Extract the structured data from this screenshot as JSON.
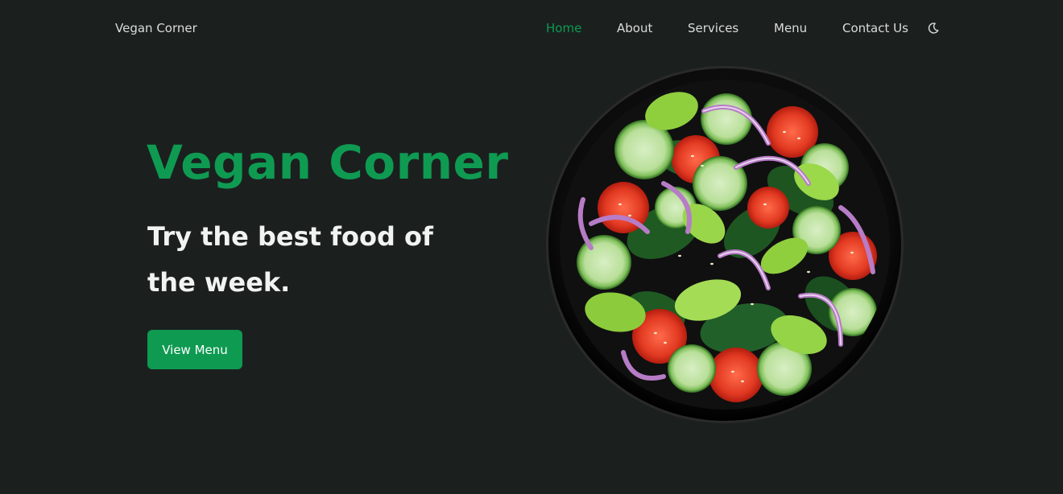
{
  "header": {
    "brand": "Vegan Corner",
    "nav": {
      "home": "Home",
      "about": "About",
      "services": "Services",
      "menu": "Menu",
      "contact": "Contact Us"
    },
    "theme_toggle_icon": "moon-icon"
  },
  "hero": {
    "title": "Vegan Corner",
    "subtitle": "Try the best food of the week.",
    "cta_label": "View Menu",
    "image_icon": "salad-bowl-image"
  },
  "colors": {
    "background": "#1b201f",
    "accent": "#0f9a52",
    "nav_text": "#d9dcda",
    "heading_text": "#f1f3f2"
  }
}
